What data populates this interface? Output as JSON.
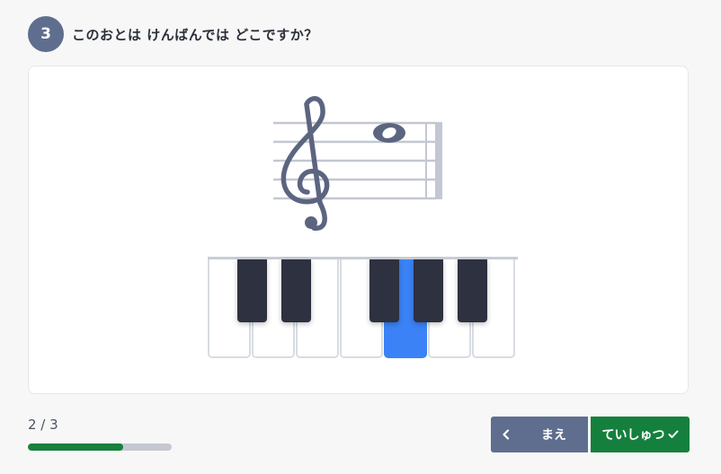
{
  "question": {
    "number": "3",
    "text": "このおとは けんばんでは どこですか？"
  },
  "keyboard": {
    "white_keys": 7,
    "black_keys_after_white": [
      0,
      1,
      3,
      4,
      5
    ],
    "selected_white_key_index": 4,
    "selected_color": "#3b82f6"
  },
  "staff": {
    "clef": "treble",
    "note": "whole note"
  },
  "progress": {
    "label": "2 / 3",
    "current": 2,
    "total": 3,
    "fill_fraction": 0.66
  },
  "buttons": {
    "prev_label": "まえ",
    "submit_label": "ていしゅつ"
  },
  "colors": {
    "accent": "#5f6e8e",
    "submit": "#15803d",
    "progress": "#16803c"
  }
}
